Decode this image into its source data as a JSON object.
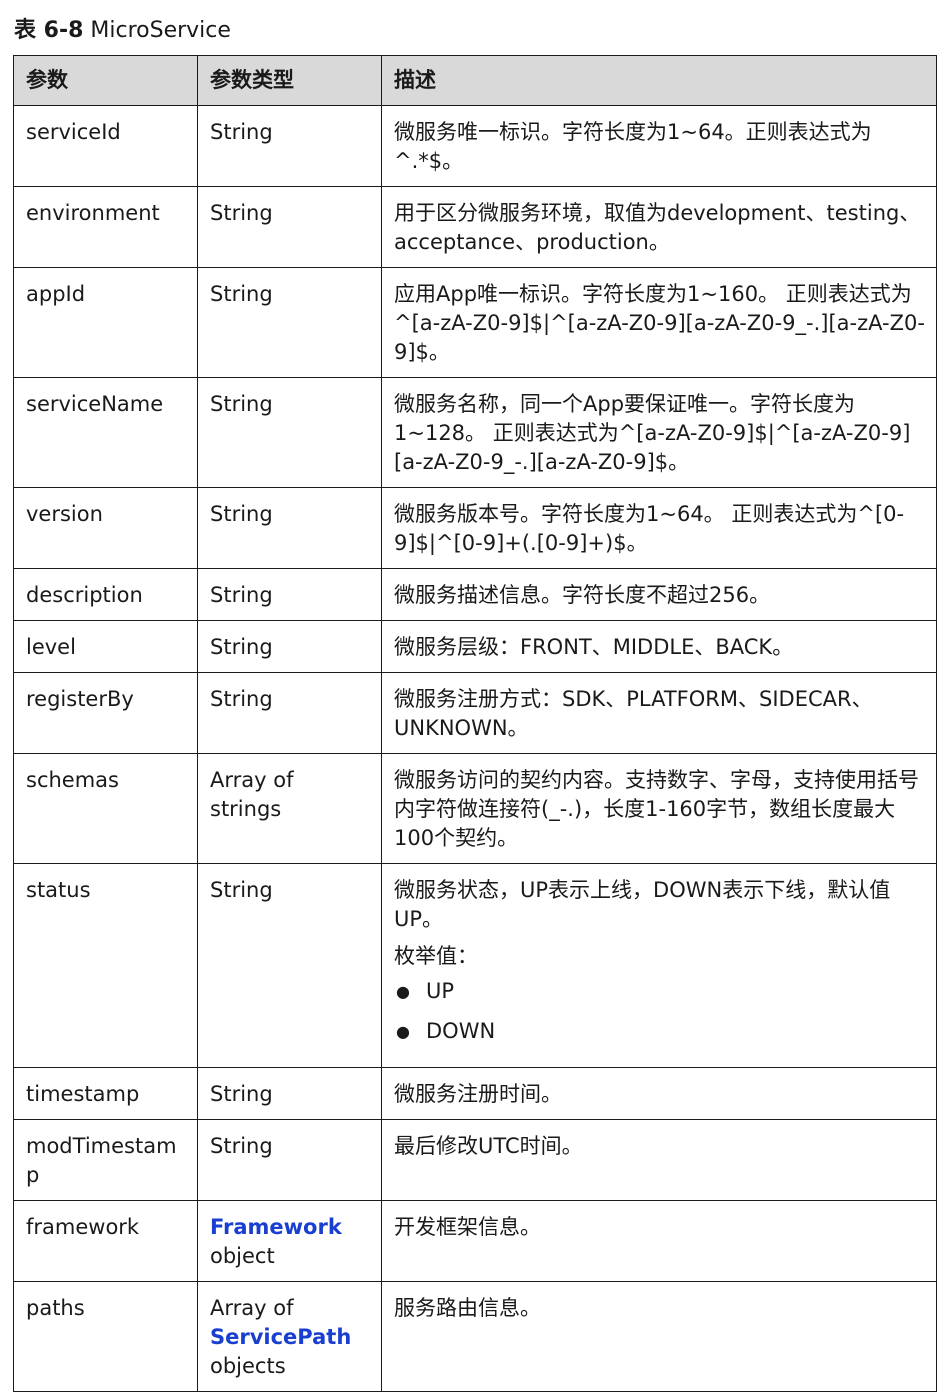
{
  "caption": {
    "number": "表 6-8",
    "title": "MicroService"
  },
  "headers": [
    "参数",
    "参数类型",
    "描述"
  ],
  "rows": [
    {
      "param": "serviceId",
      "type": "String",
      "desc": "微服务唯一标识。字符长度为1~64。正则表达式为^.*$。"
    },
    {
      "param": "environment",
      "type": "String",
      "desc": "用于区分微服务环境，取值为development、testing、acceptance、production。"
    },
    {
      "param": "appId",
      "type": "String",
      "desc": "应用App唯一标识。字符长度为1~160。 正则表达式为^[a-zA-Z0-9]$|^[a-zA-Z0-9][a-zA-Z0-9_-.][a-zA-Z0-9]$。"
    },
    {
      "param": "serviceName",
      "type": "String",
      "desc": "微服务名称，同一个App要保证唯一。字符长度为1~128。 正则表达式为^[a-zA-Z0-9]$|^[a-zA-Z0-9][a-zA-Z0-9_-.][a-zA-Z0-9]$。"
    },
    {
      "param": "version",
      "type": "String",
      "desc": "微服务版本号。字符长度为1~64。 正则表达式为^[0-9]$|^[0-9]+(.[0-9]+)$。"
    },
    {
      "param": "description",
      "type": "String",
      "desc": "微服务描述信息。字符长度不超过256。"
    },
    {
      "param": "level",
      "type": "String",
      "desc": "微服务层级：FRONT、MIDDLE、BACK。"
    },
    {
      "param": "registerBy",
      "type": "String",
      "desc": "微服务注册方式：SDK、PLATFORM、SIDECAR、UNKNOWN。"
    },
    {
      "param": "schemas",
      "type": "Array of strings",
      "desc": "微服务访问的契约内容。支持数字、字母，支持使用括号内字符做连接符(_-.)，长度1-160字节，数组长度最大100个契约。"
    },
    {
      "param": "status",
      "type": "String",
      "desc": "微服务状态，UP表示上线，DOWN表示下线，默认值UP。",
      "enum_label": "枚举值：",
      "enum_values": [
        "UP",
        "DOWN"
      ]
    },
    {
      "param": "timestamp",
      "type": "String",
      "desc": "微服务注册时间。"
    },
    {
      "param": "modTimestamp",
      "type": "String",
      "desc": "最后修改UTC时间。"
    },
    {
      "param": "framework",
      "type_link": "Framework",
      "type_suffix": "object",
      "desc": "开发框架信息。"
    },
    {
      "param": "paths",
      "type_prefix": "Array of",
      "type_link": "ServicePath",
      "type_suffix": "objects",
      "desc": "服务路由信息。"
    }
  ]
}
